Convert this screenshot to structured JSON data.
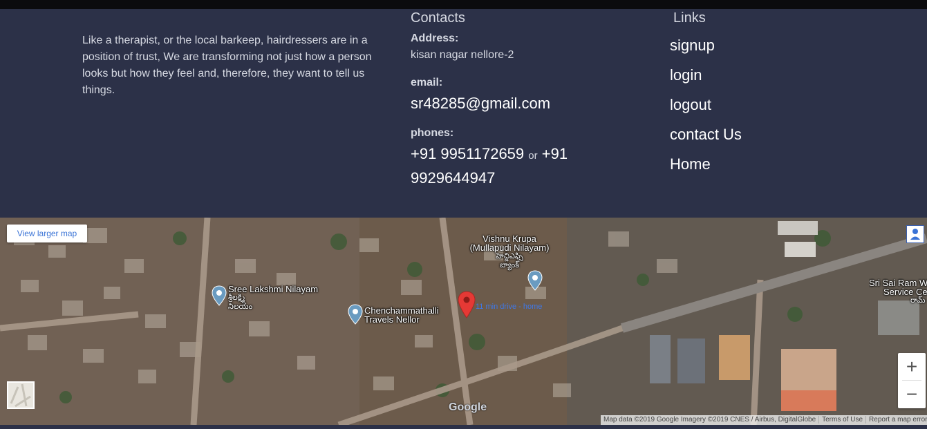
{
  "about": {
    "text": "Like a therapist, or the local barkeep, hairdressers are in a position of trust, We are transforming not just how a person looks but how they feel and, therefore, they want to tell us things."
  },
  "contacts": {
    "title": "Contacts",
    "address_label": "Address:",
    "address": "kisan nagar nellore-2",
    "email_label": "email:",
    "email": "sr48285@gmail.com",
    "phones_label": "phones:",
    "phone1": "+91 9951172659",
    "or": "or",
    "phone2": "+91 9929644947"
  },
  "links": {
    "title": "Links",
    "items": [
      {
        "label": "signup"
      },
      {
        "label": "login"
      },
      {
        "label": "logout"
      },
      {
        "label": "contact Us"
      },
      {
        "label": "Home"
      }
    ]
  },
  "map": {
    "view_larger": "View larger map",
    "places": {
      "vishnu_line1": "Vishnu Krupa",
      "vishnu_line2": "(Mullapudi Nilayam)",
      "vishnu_line3": "హెచ్డిఎఫ్సి",
      "vishnu_line4": "బ్యాంక్",
      "sree_line1": "Sree Lakshmi Nilayam",
      "sree_line2": "శ్రీలక్ష్మి",
      "sree_line3": "నిలయం",
      "chench_line1": "Chenchammathalli",
      "chench_line2": "Travels Nellor",
      "sai_line1": "Sri Sai Ram W",
      "sai_line2": "Service Ce",
      "sai_line3": "రామ్",
      "home_label": "11 min drive - home"
    },
    "google": "Google",
    "zoom_in": "+",
    "zoom_out": "−",
    "attribution": {
      "data": "Map data ©2019 Google Imagery ©2019 CNES / Airbus, DigitalGlobe",
      "terms": "Terms of Use",
      "report": "Report a map error"
    }
  }
}
